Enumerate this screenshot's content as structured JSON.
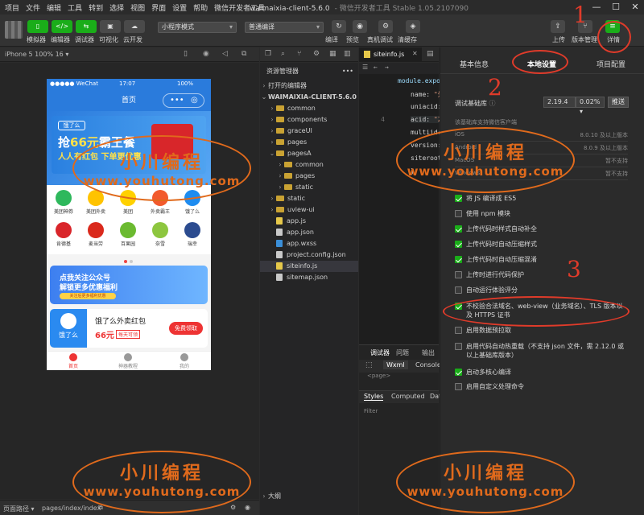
{
  "menubar": {
    "items": [
      "项目",
      "文件",
      "编辑",
      "工具",
      "转到",
      "选择",
      "视图",
      "界面",
      "设置",
      "帮助",
      "微信开发者工具"
    ],
    "window_title": "waimaixia-client-5.6.0",
    "window_subtitle": "- 微信开发者工具 Stable 1.05.2107090"
  },
  "toolbar": {
    "left_buttons": [
      {
        "label": "模拟器",
        "icon": "phone-icon"
      },
      {
        "label": "编辑器",
        "icon": "code-icon"
      },
      {
        "label": "调试器",
        "icon": "debug-icon"
      },
      {
        "label": "可视化",
        "icon": "visual-icon"
      },
      {
        "label": "云开发",
        "icon": "cloud-icon"
      }
    ],
    "mode_select": "小程序模式",
    "compile_select": "普通编译",
    "mid_buttons": [
      {
        "label": "编译",
        "icon": "refresh-icon"
      },
      {
        "label": "预览",
        "icon": "eye-icon"
      },
      {
        "label": "真机调试",
        "icon": "debug-phone-icon"
      },
      {
        "label": "清缓存",
        "icon": "layers-icon"
      }
    ],
    "right_buttons": [
      {
        "label": "上传",
        "icon": "upload-icon"
      },
      {
        "label": "版本管理",
        "icon": "branch-icon"
      },
      {
        "label": "详情",
        "icon": "menu-icon"
      }
    ]
  },
  "simulator": {
    "device_label": "iPhone 5 100% 16 ▾",
    "status_left": "●●●●● WeChat",
    "status_time": "17:07",
    "status_right": "100%",
    "nav_title": "首页",
    "banner": {
      "logo": "饿了么",
      "headline_pre": "抢",
      "headline_hl": "66元",
      "headline_post": "霸王餐",
      "sub": "人人有红包 下单更优惠"
    },
    "grid_items": [
      {
        "label": "美团神券",
        "color": "#2eb85c"
      },
      {
        "label": "美团外卖",
        "color": "#ffc300"
      },
      {
        "label": "美团",
        "color": "#ffd100"
      },
      {
        "label": "外卖霸王",
        "color": "#f25a2d"
      },
      {
        "label": "饿了么",
        "color": "#1e8cf0"
      },
      {
        "label": "肯德基",
        "color": "#d9252a"
      },
      {
        "label": "麦当劳",
        "color": "#da291c"
      },
      {
        "label": "百果园",
        "color": "#6bba30"
      },
      {
        "label": "奈雪",
        "color": "#8dc63f"
      },
      {
        "label": "瑞幸",
        "color": "#2b4b8f"
      }
    ],
    "promo": {
      "line1": "点我关注公众号",
      "line2": "解锁更多优惠福利",
      "line3": "关注后更多福利优惠"
    },
    "coupon": {
      "left": "饿了么",
      "title": "饿了么外卖红包",
      "amount": "66元",
      "tag": "每天可领",
      "button": "免费领取"
    },
    "tabs": [
      "首页",
      "神器教程",
      "我的"
    ]
  },
  "simfooter": {
    "path_label": "页面路径 ▾",
    "path": "pages/index/index"
  },
  "explorer": {
    "header": "资源管理器",
    "open_editors": "打开的编辑器",
    "project": "WAIMAIXIA-CLIENT-5.6.0",
    "items": [
      {
        "name": "common",
        "type": "folder",
        "depth": 1
      },
      {
        "name": "components",
        "type": "folder",
        "depth": 1
      },
      {
        "name": "graceUI",
        "type": "folder",
        "depth": 1
      },
      {
        "name": "pages",
        "type": "folder",
        "depth": 1
      },
      {
        "name": "pagesA",
        "type": "folder-open",
        "depth": 1
      },
      {
        "name": "common",
        "type": "folder",
        "depth": 2
      },
      {
        "name": "pages",
        "type": "folder",
        "depth": 2
      },
      {
        "name": "static",
        "type": "folder",
        "depth": 2
      },
      {
        "name": "static",
        "type": "folder",
        "depth": 1
      },
      {
        "name": "uview-ui",
        "type": "folder",
        "depth": 1
      },
      {
        "name": "app.js",
        "type": "js",
        "depth": 1
      },
      {
        "name": "app.json",
        "type": "json",
        "depth": 1
      },
      {
        "name": "app.wxss",
        "type": "wxss",
        "depth": 1
      },
      {
        "name": "project.config.json",
        "type": "json",
        "depth": 1
      },
      {
        "name": "siteinfo.js",
        "type": "js",
        "depth": 1
      },
      {
        "name": "sitemap.json",
        "type": "json",
        "depth": 1
      }
    ],
    "outline": "大纲"
  },
  "editor": {
    "tab": "siteinfo.js",
    "lines": [
      {
        "n": "",
        "parts": [
          [
            "k",
            "module.expor"
          ]
        ]
      },
      {
        "n": "",
        "parts": [
          [
            "",
            "name: "
          ],
          [
            "s",
            "\"外"
          ]
        ]
      },
      {
        "n": "",
        "parts": [
          [
            "",
            "uniacid: "
          ]
        ]
      },
      {
        "n": "4",
        "parts": [
          [
            "",
            "acid: "
          ],
          [
            "s",
            "\"2"
          ]
        ]
      },
      {
        "n": "",
        "parts": [
          [
            "",
            "multiid: "
          ]
        ]
      },
      {
        "n": "",
        "parts": [
          [
            "",
            "version: "
          ]
        ]
      },
      {
        "n": "",
        "parts": [
          [
            "",
            "siteroot: "
          ]
        ]
      },
      {
        "n": "",
        "parts": [
          [
            "",
            "}"
          ]
        ]
      }
    ]
  },
  "devtools": {
    "tabs": [
      "调试器",
      "问题",
      "输出"
    ],
    "subtabs": [
      "Wxml",
      "Console"
    ],
    "page_node": "<page>",
    "style_tabs": [
      "Styles",
      "Computed",
      "Dat"
    ],
    "filter": "Filter"
  },
  "settings": {
    "tabs": [
      "基本信息",
      "本地设置",
      "项目配置"
    ],
    "base_lib_label": "调试基础库",
    "base_lib_version": "2.19.4",
    "base_lib_pct": "0.02% ▾",
    "push_label": "推送",
    "support_note": "该基础库支持微信客户端",
    "platforms": [
      {
        "name": "iOS",
        "value": "8.0.10 及以上版本"
      },
      {
        "name": "Android",
        "value": "8.0.9 及以上版本"
      },
      {
        "name": "MacOS",
        "value": "暂不支持"
      },
      {
        "name": "Windows",
        "value": "暂不支持"
      }
    ],
    "options": [
      {
        "label": "将 JS 编译成 ES5",
        "checked": true
      },
      {
        "label": "使用 npm 模块",
        "checked": false
      },
      {
        "label": "上传代码时样式自动补全",
        "checked": true
      },
      {
        "label": "上传代码时自动压缩样式",
        "checked": true
      },
      {
        "label": "上传代码时自动压缩混淆",
        "checked": true
      },
      {
        "label": "上传时进行代码保护",
        "checked": false
      },
      {
        "label": "自动运行体验评分",
        "checked": false
      },
      {
        "label": "不校验合法域名、web-view（业务域名）、TLS 版本以及 HTTPS 证书",
        "checked": true
      },
      {
        "label": "启用数据预拉取",
        "checked": false
      },
      {
        "label": "启用代码自动热重载（不支持 json 文件，需 2.12.0 或以上基础库版本）",
        "checked": false
      },
      {
        "label": "启动多核心编译",
        "checked": true
      },
      {
        "label": "启用自定义处理命令",
        "checked": false
      }
    ]
  },
  "annotations": {
    "numbers": [
      "1",
      "2",
      "3"
    ],
    "watermark_cn": "小川编程",
    "watermark_url": "www.youhutong.com"
  },
  "colors": {
    "accent": "#1aad19",
    "annotation": "#e03b2a",
    "watermark": "#e06a1c"
  }
}
